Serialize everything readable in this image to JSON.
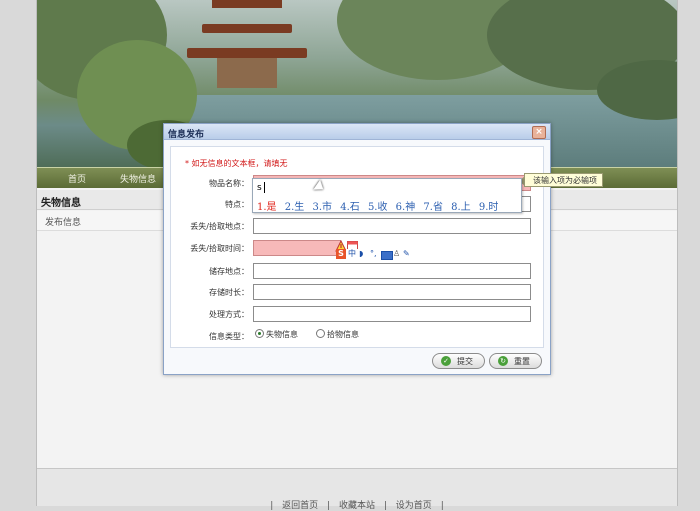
{
  "nav": {
    "items": [
      "首页",
      "失物信息"
    ]
  },
  "sidebar": {
    "title": "失物信息",
    "sub_item": "发布信息"
  },
  "footer": {
    "links": [
      "|",
      "返回首页",
      "|",
      "收藏本站",
      "|",
      "设为首页",
      "|"
    ]
  },
  "dialog": {
    "title": "信息发布",
    "close_label": "×",
    "notice": "* 如无信息的文本框，请填无",
    "fields": [
      {
        "label": "物品名称：",
        "value": "",
        "error_mark": "X"
      },
      {
        "label": "特点：",
        "value": ""
      },
      {
        "label": "丢失/拾取地点：",
        "value": ""
      },
      {
        "label": "丢失/拾取时间：",
        "value": ""
      },
      {
        "label": "储存地点：",
        "value": ""
      },
      {
        "label": "存储时长：",
        "value": ""
      },
      {
        "label": "处理方式：",
        "value": ""
      }
    ],
    "type_label": "信息类型：",
    "type_options": [
      "失物信息",
      "拾物信息"
    ],
    "submit_label": "提交",
    "reset_label": "重置"
  },
  "tooltip": "该输入项为必输项",
  "ime": {
    "typed": "s",
    "candidates": [
      "1.是",
      "2.生",
      "3.市",
      "4.石",
      "5.收",
      "6.神",
      "7.省",
      "8.上",
      "9.时"
    ],
    "toolbar_logo": "S",
    "toolbar_mode": "中"
  },
  "colors": {
    "error_bg": "#f7b9b9",
    "notice": "#d21a1a",
    "nav_bg": "#6e7d45",
    "candidate": "#2c5fb0",
    "candidate_selected": "#e0241b"
  }
}
